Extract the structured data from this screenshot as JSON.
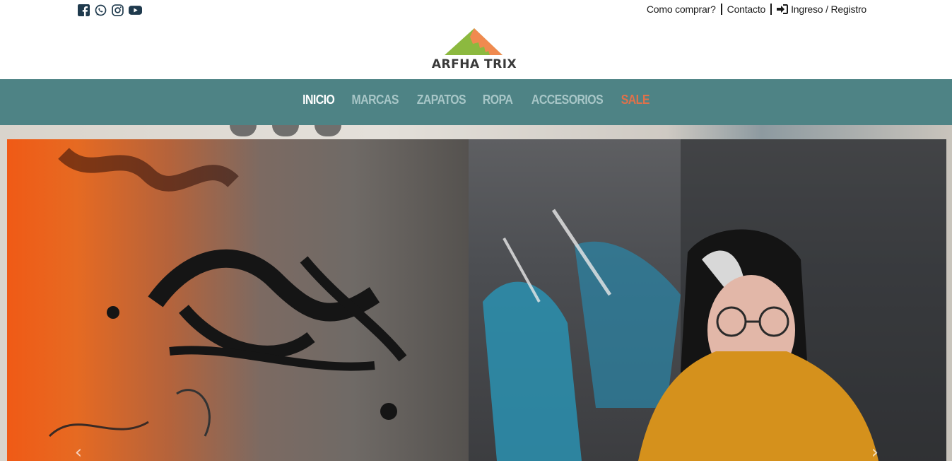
{
  "colors": {
    "nav_bg": "#4e8385",
    "nav_active": "#ffffff",
    "nav_inactive": "#a7c6c7",
    "nav_sale": "#e0714a",
    "logo_orange": "#f08a4f",
    "logo_green": "#8cb93f"
  },
  "social": [
    {
      "icon": "facebook-icon"
    },
    {
      "icon": "whatsapp-icon"
    },
    {
      "icon": "instagram-icon"
    },
    {
      "icon": "youtube-icon"
    }
  ],
  "toplinks": {
    "how_to_buy": "Como comprar?",
    "contact": "Contacto",
    "login": "Ingreso / Registro",
    "login_icon": "sign-in-icon"
  },
  "logo": {
    "text": "ARFHA TRIX"
  },
  "nav": {
    "items": [
      {
        "label": "INICIO",
        "state": "active"
      },
      {
        "label": "MARCAS",
        "state": "normal"
      },
      {
        "label": "ZAPATOS",
        "state": "normal"
      },
      {
        "label": "ROPA",
        "state": "normal"
      },
      {
        "label": "ACCESORIOS",
        "state": "normal"
      },
      {
        "label": "SALE",
        "state": "sale"
      }
    ]
  },
  "carousel": {
    "prev_icon": "chevron-left-icon",
    "next_icon": "chevron-right-icon",
    "prev_glyph": "‹",
    "next_glyph": "›"
  }
}
